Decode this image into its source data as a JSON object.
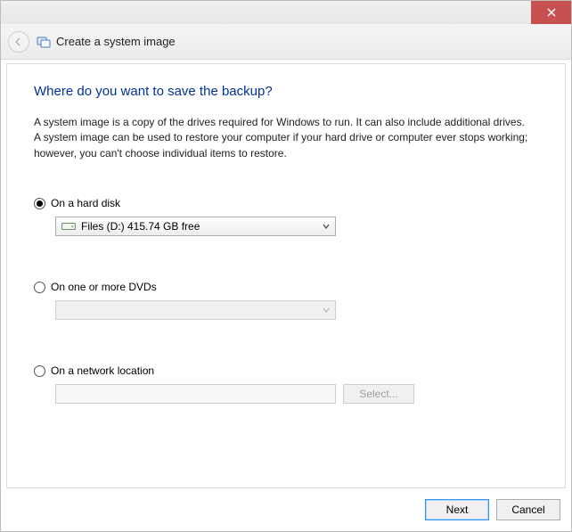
{
  "window": {
    "title": "Create a system image"
  },
  "page": {
    "heading": "Where do you want to save the backup?",
    "description": "A system image is a copy of the drives required for Windows to run. It can also include additional drives. A system image can be used to restore your computer if your hard drive or computer ever stops working; however, you can't choose individual items to restore."
  },
  "options": {
    "hard_disk": {
      "label": "On a hard disk",
      "selected_drive": "Files (D:)  415.74 GB free",
      "checked": true
    },
    "dvd": {
      "label": "On one or more DVDs",
      "checked": false
    },
    "network": {
      "label": "On a network location",
      "select_button": "Select...",
      "value": "",
      "checked": false
    }
  },
  "buttons": {
    "next": "Next",
    "cancel": "Cancel"
  }
}
